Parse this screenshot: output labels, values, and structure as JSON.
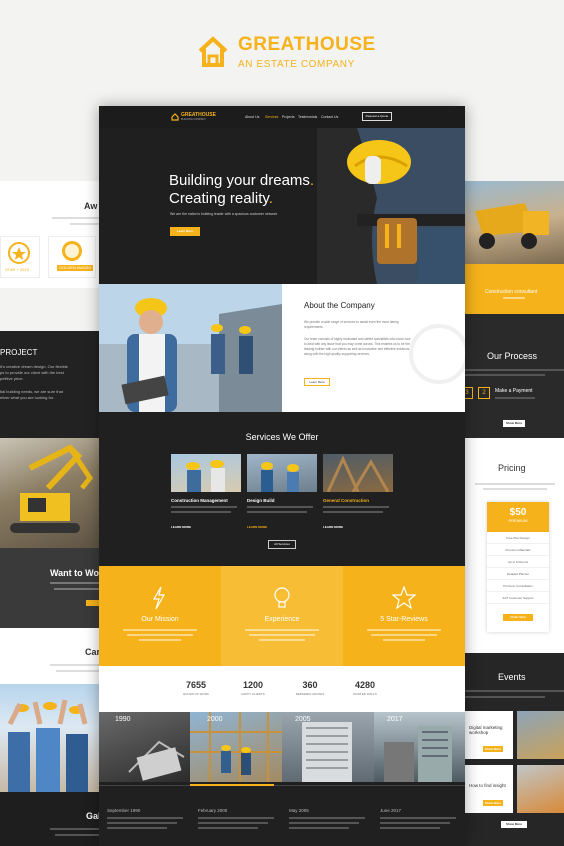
{
  "brand": {
    "name_a": "GREAT",
    "name_b": "HOUSE",
    "tagline": "AN ESTATE COMPANY",
    "accent": "#f5b21b"
  },
  "nav": {
    "logo_a": "GREAT",
    "logo_b": "HOUSE",
    "logo_sub": "BUILDING COMPANY",
    "items": [
      "About Us",
      "Services",
      "Projects",
      "Testimonials",
      "Contact Us"
    ],
    "cta": "Request a Quote"
  },
  "hero": {
    "line1": "Building your dreams",
    "line2": "Creating reality",
    "sub": "We are the nation's building leader with a spacious customer network",
    "button": "Learn More"
  },
  "about": {
    "title": "About the Company",
    "p1": "We provide a wide range of services to assist even the most daring requirements.",
    "p2": "Our team consists of highly motivated and skilled specialists who know how to deal with any issue that you may come across. This enables us to be the leading builder with our clients as well as innovative and effective solutions along with the high quality supporting services.",
    "button": "Learn More"
  },
  "services": {
    "title": "Services We Offer",
    "items": [
      {
        "title": "Construction Management",
        "more": "LEARN MORE"
      },
      {
        "title": "Design Build",
        "more": "LEARN MORE"
      },
      {
        "title": "General Construction",
        "more": "LEARN MORE"
      }
    ],
    "button": "All Services"
  },
  "features": [
    {
      "title": "Our Mission",
      "icon": "lightning-icon"
    },
    {
      "title": "Experience",
      "icon": "bulb-icon"
    },
    {
      "title": "5 Star-Reviews",
      "icon": "star-icon"
    }
  ],
  "stats": [
    {
      "value": "7655",
      "label": "HOURS OF WORK"
    },
    {
      "value": "1200",
      "label": "HAPPY CLIENTS"
    },
    {
      "value": "360",
      "label": "REPAIRED HOUSES"
    },
    {
      "value": "4280",
      "label": "PAINTED WALLS"
    }
  ],
  "years": [
    "1990",
    "2000",
    "2005",
    "2017"
  ],
  "timeline": [
    "September 1990",
    "February 2000",
    "May 2005",
    "June 2017"
  ],
  "left": {
    "awards_title": "Aw",
    "award1": "STAR + 2015",
    "award2": "GOLDEN AWARD",
    "project_title": "PROJECT",
    "project_p1": "It's creative dream design. Our flexible",
    "project_p2": "ps to provide our client with the best",
    "project_p3": "petitive price.",
    "project_p4": "tial building needs, we are sure that",
    "project_p5": "eliver what you are looking for.",
    "want": "Want to Wo",
    "car": "Car",
    "gal": "Gal"
  },
  "right": {
    "consult": "Construction consultant",
    "process_title": "Our Process",
    "step2": "2",
    "step3": "3",
    "make_payment": "Make a Payment",
    "more": "Show More",
    "pricing_title": "Pricing",
    "price": "$50",
    "price_sub": "PREMIUM",
    "plan_items": [
      "Free Plan Design",
      "Premium Materials",
      "Up to 5 Rooms",
      "Detailed Planner",
      "Premium Consultation",
      "24/7 Customer Support"
    ],
    "plan_button": "Order Now",
    "events_title": "Events",
    "event1": "Digital marketing workshop",
    "event2": "How to find insight",
    "event_btn": "Show More"
  }
}
